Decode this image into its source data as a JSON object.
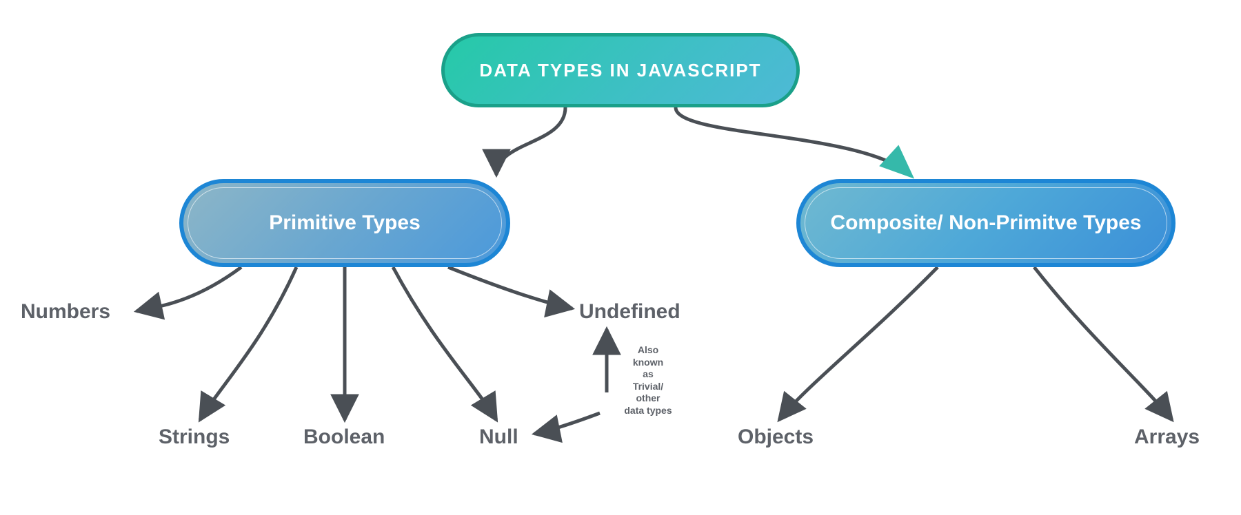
{
  "root": {
    "title": "DATA TYPES IN JAVASCRIPT"
  },
  "branches": {
    "primitive": {
      "label": "Primitive Types",
      "leaves": {
        "numbers": "Numbers",
        "strings": "Strings",
        "boolean": "Boolean",
        "null": "Null",
        "undefined": "Undefined"
      }
    },
    "composite": {
      "label": "Composite/ Non-Primitve Types",
      "leaves": {
        "objects": "Objects",
        "arrays": "Arrays"
      }
    }
  },
  "note": {
    "line1": "Also",
    "line2": "known",
    "line3": "as",
    "line4": "Trivial/",
    "line5": "other",
    "line6": "data types"
  },
  "colors": {
    "connector": "#4a4f55",
    "rootFillStart": "#26c9a8",
    "rootFillEnd": "#4eb9d6",
    "rootBorder": "#1aa089",
    "secondBorder": "#1d86d5",
    "leafText": "#5d6168"
  }
}
